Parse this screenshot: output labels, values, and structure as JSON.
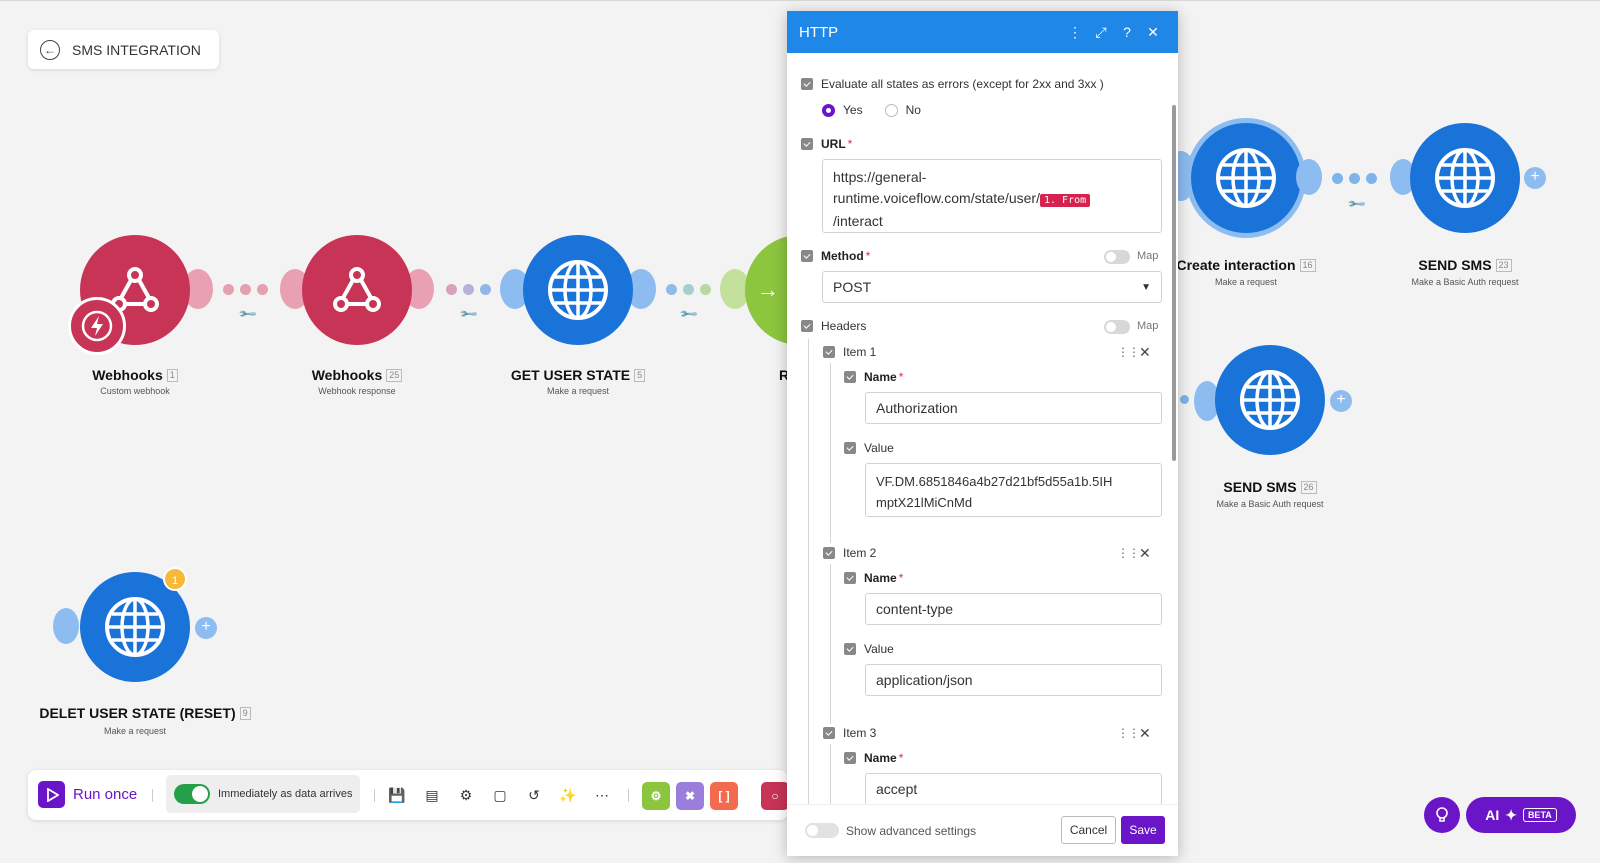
{
  "scenario": {
    "title": "SMS INTEGRATION"
  },
  "modules": [
    {
      "label": "Webhooks",
      "number": "1",
      "sub": "Custom webhook"
    },
    {
      "label": "Webhooks",
      "number": "25",
      "sub": "Webhook response"
    },
    {
      "label": "GET USER STATE",
      "number": "5",
      "sub": "Make a request"
    },
    {
      "label": "R",
      "number": "",
      "sub": ""
    },
    {
      "label": "Create interaction",
      "number": "16",
      "sub": "Make a request"
    },
    {
      "label": "SEND SMS",
      "number": "23",
      "sub": "Make a Basic Auth request"
    },
    {
      "label": "SEND SMS",
      "number": "26",
      "sub": "Make a Basic Auth request"
    },
    {
      "label": "DELET USER STATE (RESET)",
      "number": "9",
      "sub": "Make a request",
      "badge": "1"
    }
  ],
  "toolbar": {
    "run_label": "Run once",
    "schedule_label": "Immediately as data arrives"
  },
  "modal": {
    "title": "HTTP",
    "evaluate_label": "Evaluate all states as errors (except for 2xx and 3xx )",
    "yes_label": "Yes",
    "no_label": "No",
    "url_label": "URL",
    "url_line1": "https://general-",
    "url_line2": "runtime.voiceflow.com/state/user/",
    "url_pill": "1. From",
    "url_line3": "/interact",
    "method_label": "Method",
    "method_value": "POST",
    "map_label": "Map",
    "headers_label": "Headers",
    "items": [
      {
        "label": "Item 1",
        "name_label": "Name",
        "name_value": "Authorization",
        "value_label": "Value",
        "value_line1": "VF.DM.6851846a4b27d21bf5d55a1b.5IH",
        "value_line2": "mptX21lMiCnMd"
      },
      {
        "label": "Item 2",
        "name_label": "Name",
        "name_value": "content-type",
        "value_label": "Value",
        "value_line1": "application/json"
      },
      {
        "label": "Item 3",
        "name_label": "Name",
        "name_value": "accept"
      }
    ],
    "advanced_label": "Show advanced settings",
    "cancel_label": "Cancel",
    "save_label": "Save"
  },
  "ai": {
    "label": "AI",
    "beta": "BETA"
  },
  "colors": {
    "webhook": "#c73456",
    "http": "#1a73d9",
    "router": "#8cc63f",
    "accent": "#6b15c9",
    "header": "#1e87e7"
  },
  "icons": [
    "back-arrow-icon",
    "webhook-icon",
    "instant-trigger-icon",
    "globe-icon",
    "router-arrow-icon",
    "wrench-icon",
    "plus-icon",
    "play-icon",
    "save-icon",
    "controller-icon",
    "settings-icon",
    "notes-icon",
    "undo-icon",
    "magic-wand-icon",
    "more-icon",
    "more-vertical-icon",
    "expand-icon",
    "help-icon",
    "close-icon",
    "drag-handle-icon",
    "lightbulb-icon",
    "sparkle-icon"
  ]
}
